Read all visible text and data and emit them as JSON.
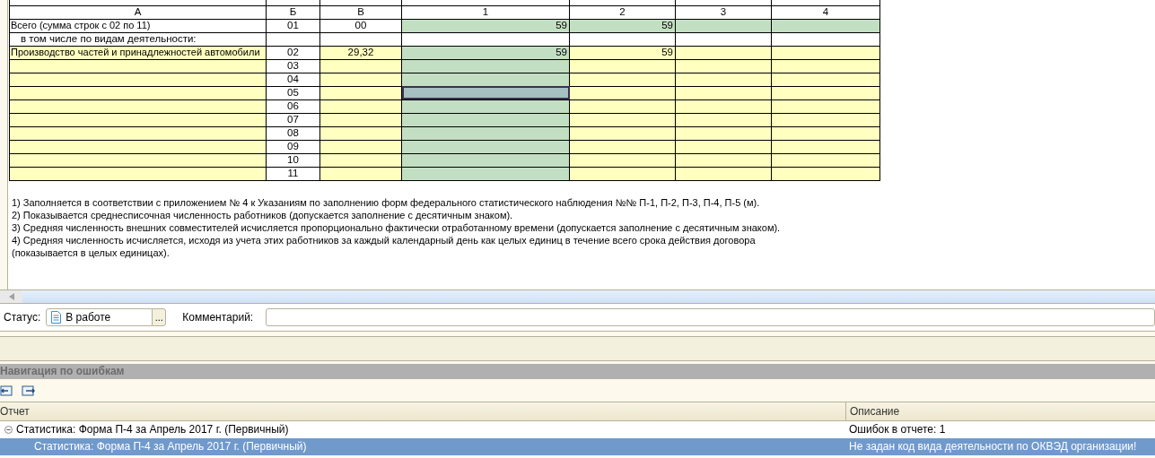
{
  "form_table": {
    "columns": [
      "А",
      "Б",
      "В",
      "1",
      "2",
      "3",
      "4"
    ],
    "rows": [
      {
        "cells": [
          {
            "text": "Всего (сумма строк с 02 по 11)",
            "kind": "plain",
            "selected": false
          },
          {
            "text": "01",
            "kind": "plain",
            "selected": false
          },
          {
            "text": "00",
            "kind": "plain",
            "selected": false
          },
          {
            "text": "59",
            "kind": "computed",
            "selected": false
          },
          {
            "text": "59",
            "kind": "computed",
            "selected": false
          },
          {
            "text": "",
            "kind": "computed",
            "selected": false
          },
          {
            "text": "",
            "kind": "computed",
            "selected": false
          }
        ]
      },
      {
        "kind": "subheading",
        "text": "в том числе по видам деятельности:"
      },
      {
        "cells": [
          {
            "text": "Производство частей и принадлежностей автомобили",
            "kind": "input",
            "selected": false
          },
          {
            "text": "02",
            "kind": "plain",
            "selected": false
          },
          {
            "text": "29,32",
            "kind": "input",
            "selected": false
          },
          {
            "text": "59",
            "kind": "computed",
            "selected": false
          },
          {
            "text": "59",
            "kind": "input",
            "selected": false
          },
          {
            "text": "",
            "kind": "input",
            "selected": false
          },
          {
            "text": "",
            "kind": "input",
            "selected": false
          }
        ]
      },
      {
        "cells": [
          {
            "text": "",
            "kind": "input",
            "selected": false
          },
          {
            "text": "03",
            "kind": "plain",
            "selected": false
          },
          {
            "text": "",
            "kind": "input",
            "selected": false
          },
          {
            "text": "",
            "kind": "computed",
            "selected": false
          },
          {
            "text": "",
            "kind": "input",
            "selected": false
          },
          {
            "text": "",
            "kind": "input",
            "selected": false
          },
          {
            "text": "",
            "kind": "input",
            "selected": false
          }
        ]
      },
      {
        "cells": [
          {
            "text": "",
            "kind": "input",
            "selected": false
          },
          {
            "text": "04",
            "kind": "plain",
            "selected": false
          },
          {
            "text": "",
            "kind": "input",
            "selected": false
          },
          {
            "text": "",
            "kind": "computed",
            "selected": false
          },
          {
            "text": "",
            "kind": "input",
            "selected": false
          },
          {
            "text": "",
            "kind": "input",
            "selected": false
          },
          {
            "text": "",
            "kind": "input",
            "selected": false
          }
        ]
      },
      {
        "cells": [
          {
            "text": "",
            "kind": "input",
            "selected": false
          },
          {
            "text": "05",
            "kind": "plain",
            "selected": false
          },
          {
            "text": "",
            "kind": "input",
            "selected": false
          },
          {
            "text": "",
            "kind": "computed",
            "selected": true
          },
          {
            "text": "",
            "kind": "input",
            "selected": false
          },
          {
            "text": "",
            "kind": "input",
            "selected": false
          },
          {
            "text": "",
            "kind": "input",
            "selected": false
          }
        ]
      },
      {
        "cells": [
          {
            "text": "",
            "kind": "input",
            "selected": false
          },
          {
            "text": "06",
            "kind": "plain",
            "selected": false
          },
          {
            "text": "",
            "kind": "input",
            "selected": false
          },
          {
            "text": "",
            "kind": "computed",
            "selected": false
          },
          {
            "text": "",
            "kind": "input",
            "selected": false
          },
          {
            "text": "",
            "kind": "input",
            "selected": false
          },
          {
            "text": "",
            "kind": "input",
            "selected": false
          }
        ]
      },
      {
        "cells": [
          {
            "text": "",
            "kind": "input",
            "selected": false
          },
          {
            "text": "07",
            "kind": "plain",
            "selected": false
          },
          {
            "text": "",
            "kind": "input",
            "selected": false
          },
          {
            "text": "",
            "kind": "computed",
            "selected": false
          },
          {
            "text": "",
            "kind": "input",
            "selected": false
          },
          {
            "text": "",
            "kind": "input",
            "selected": false
          },
          {
            "text": "",
            "kind": "input",
            "selected": false
          }
        ]
      },
      {
        "cells": [
          {
            "text": "",
            "kind": "input",
            "selected": false
          },
          {
            "text": "08",
            "kind": "plain",
            "selected": false
          },
          {
            "text": "",
            "kind": "input",
            "selected": false
          },
          {
            "text": "",
            "kind": "computed",
            "selected": false
          },
          {
            "text": "",
            "kind": "input",
            "selected": false
          },
          {
            "text": "",
            "kind": "input",
            "selected": false
          },
          {
            "text": "",
            "kind": "input",
            "selected": false
          }
        ]
      },
      {
        "cells": [
          {
            "text": "",
            "kind": "input",
            "selected": false
          },
          {
            "text": "09",
            "kind": "plain",
            "selected": false
          },
          {
            "text": "",
            "kind": "input",
            "selected": false
          },
          {
            "text": "",
            "kind": "computed",
            "selected": false
          },
          {
            "text": "",
            "kind": "input",
            "selected": false
          },
          {
            "text": "",
            "kind": "input",
            "selected": false
          },
          {
            "text": "",
            "kind": "input",
            "selected": false
          }
        ]
      },
      {
        "cells": [
          {
            "text": "",
            "kind": "input",
            "selected": false
          },
          {
            "text": "10",
            "kind": "plain",
            "selected": false
          },
          {
            "text": "",
            "kind": "input",
            "selected": false
          },
          {
            "text": "",
            "kind": "computed",
            "selected": false
          },
          {
            "text": "",
            "kind": "input",
            "selected": false
          },
          {
            "text": "",
            "kind": "input",
            "selected": false
          },
          {
            "text": "",
            "kind": "input",
            "selected": false
          }
        ]
      },
      {
        "cells": [
          {
            "text": "",
            "kind": "input",
            "selected": false
          },
          {
            "text": "11",
            "kind": "plain",
            "selected": false
          },
          {
            "text": "",
            "kind": "input",
            "selected": false
          },
          {
            "text": "",
            "kind": "computed",
            "selected": false
          },
          {
            "text": "",
            "kind": "input",
            "selected": false
          },
          {
            "text": "",
            "kind": "input",
            "selected": false
          },
          {
            "text": "",
            "kind": "input",
            "selected": false
          }
        ]
      }
    ]
  },
  "notes": [
    "1)  Заполняется в соответствии с приложением № 4 к Указаниям по заполнению форм федерального статистического наблюдения №№ П-1, П-2, П-3, П-4, П-5 (м).",
    "2) Показывается среднесписочная численность работников (допускается заполнение с десятичным знаком).",
    "3)  Средняя численность внешних совместителей исчисляется пропорционально фактически отработанному времени (допускается заполнение с десятичным знаком).",
    "4)  Средняя численность исчисляется, исходя из учета этих работников за каждый календарный день как целых единиц в течение всего срока действия договора",
    "(показывается в целых единицах)."
  ],
  "status_bar": {
    "status_label": "Статус:",
    "status_value": "В работе",
    "choose_button": "...",
    "comment_label": "Комментарий:"
  },
  "error_navigation": {
    "title": "Навигация по ошибкам",
    "columns": [
      "Отчет",
      "Описание"
    ],
    "rows": [
      {
        "report": "Статистика: Форма П-4 за Апрель 2017 г. (Первичный)",
        "description": "Ошибок в отчете: 1",
        "expanded": true,
        "selected": false,
        "children": [
          {
            "report": "Статистика: Форма П-4 за Апрель 2017 г. (Первичный)",
            "description": "Не задан код вида деятельности по ОКВЭД организации!",
            "selected": true
          }
        ]
      }
    ]
  }
}
